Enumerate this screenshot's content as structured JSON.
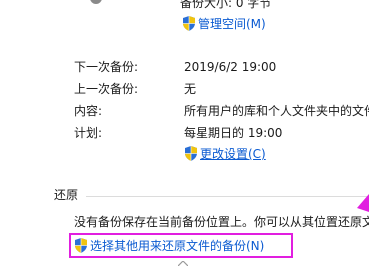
{
  "backup": {
    "size_text": "备份大小: 0 字节",
    "manage_space_link": "管理空间(M)",
    "rows": [
      {
        "label": "下一次备份:",
        "value": "2019/6/2 19:00"
      },
      {
        "label": "上一次备份:",
        "value": "无"
      },
      {
        "label": "内容:",
        "value": "所有用户的库和个人文件夹中的文件"
      },
      {
        "label": "计划:",
        "value": "每星期日的 19:00"
      }
    ],
    "change_settings_link": "更改设置(C)"
  },
  "restore": {
    "section_title": "还原",
    "message": "没有备份保存在当前备份位置上。你可以从其位置还原文件",
    "select_other_link": "选择其他用来还原文件的备份(N)"
  },
  "colors": {
    "link": "#0a5ad1",
    "highlight": "#e11ee0"
  },
  "icons": {
    "uac_shield": "uac-shield-icon",
    "annotation_arrow": "annotation-arrow-icon"
  }
}
